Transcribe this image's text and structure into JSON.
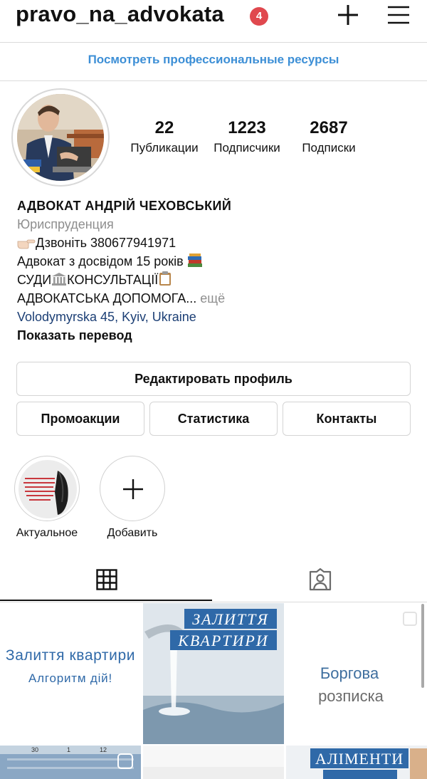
{
  "header": {
    "username": "pravo_na_advokata",
    "notification_count": "4"
  },
  "pro_resources_link": "Посмотреть профессиональные ресурсы",
  "stats": [
    {
      "value": "22",
      "label": "Публикации"
    },
    {
      "value": "1223",
      "label": "Подписчики"
    },
    {
      "value": "2687",
      "label": "Подписки"
    }
  ],
  "bio": {
    "name": "АДВОКАТ АНДРІЙ ЧЕХОВСЬКИЙ",
    "category": "Юриспруденция",
    "line1": "Дзвоніть 380677941971",
    "line2": "Адвокат з досвідом 15 років",
    "line3": "СУДИ",
    "line3b": "КОНСУЛЬТАЦІЇ",
    "line4": "АДВОКАТСЬКА ДОПОМОГА...",
    "more": "ещё",
    "location": "Volodymyrska 45, Kyiv, Ukraine",
    "translate": "Показать перевод"
  },
  "buttons": {
    "edit_profile": "Редактировать профиль",
    "promotions": "Промоакции",
    "statistics": "Статистика",
    "contacts": "Контакты"
  },
  "highlights": [
    {
      "label": "Актуальное"
    },
    {
      "label": "Добавить"
    }
  ],
  "tabs": [
    {
      "icon": "grid-icon",
      "active": true
    },
    {
      "icon": "tagged-person-icon",
      "active": false
    }
  ],
  "posts": [
    {
      "title": "Залиття квартири",
      "subtitle": "Алгоритм дій!"
    },
    {
      "title": "ЗАЛИТТЯ",
      "subtitle": "КВАРТИРИ"
    },
    {
      "title": "Боргова",
      "subtitle": "розписка"
    },
    {
      "title": "",
      "subtitle": ""
    },
    {
      "title": "",
      "subtitle": ""
    },
    {
      "title": "АЛІМЕНТИ",
      "subtitle": ""
    }
  ],
  "colors": {
    "link_blue": "#3d8fd6",
    "location_blue": "#1c3f75",
    "badge_red": "#e0484e",
    "muted_gray": "#8e8e8e"
  }
}
